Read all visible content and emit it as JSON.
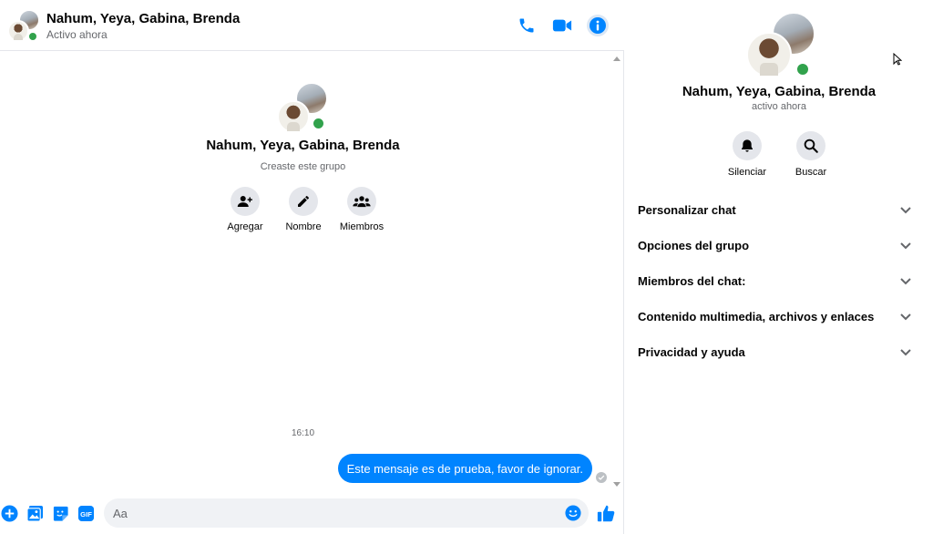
{
  "header": {
    "title": "Nahum, Yeya, Gabina, Brenda",
    "status": "Activo ahora"
  },
  "intro": {
    "title": "Nahum, Yeya, Gabina, Brenda",
    "subtitle": "Creaste este grupo",
    "actions": [
      {
        "label": "Agregar",
        "icon": "add-person-icon"
      },
      {
        "label": "Nombre",
        "icon": "pencil-icon"
      },
      {
        "label": "Miembros",
        "icon": "members-icon"
      }
    ]
  },
  "messages": {
    "timestamp": "16:10",
    "items": [
      {
        "text": "Este mensaje es de prueba, favor de ignorar.",
        "outgoing": true
      }
    ]
  },
  "composer": {
    "placeholder": "Aa",
    "icons": [
      "plus-icon",
      "image-icon",
      "sticker-icon",
      "gif-icon",
      "emoji-icon",
      "like-icon"
    ],
    "gif_label": "GIF"
  },
  "info": {
    "title": "Nahum, Yeya, Gabina, Brenda",
    "status": "activo ahora",
    "actions": [
      {
        "label": "Silenciar",
        "icon": "bell-icon"
      },
      {
        "label": "Buscar",
        "icon": "search-icon"
      }
    ],
    "sections": [
      {
        "label": "Personalizar chat"
      },
      {
        "label": "Opciones del grupo"
      },
      {
        "label": "Miembros del chat:"
      },
      {
        "label": "Contenido multimedia, archivos y enlaces"
      },
      {
        "label": "Privacidad y ayuda"
      }
    ]
  },
  "colors": {
    "accent": "#0084ff",
    "online": "#31a24c",
    "secondary_text": "#65676b",
    "button_bg": "#e4e6eb"
  }
}
